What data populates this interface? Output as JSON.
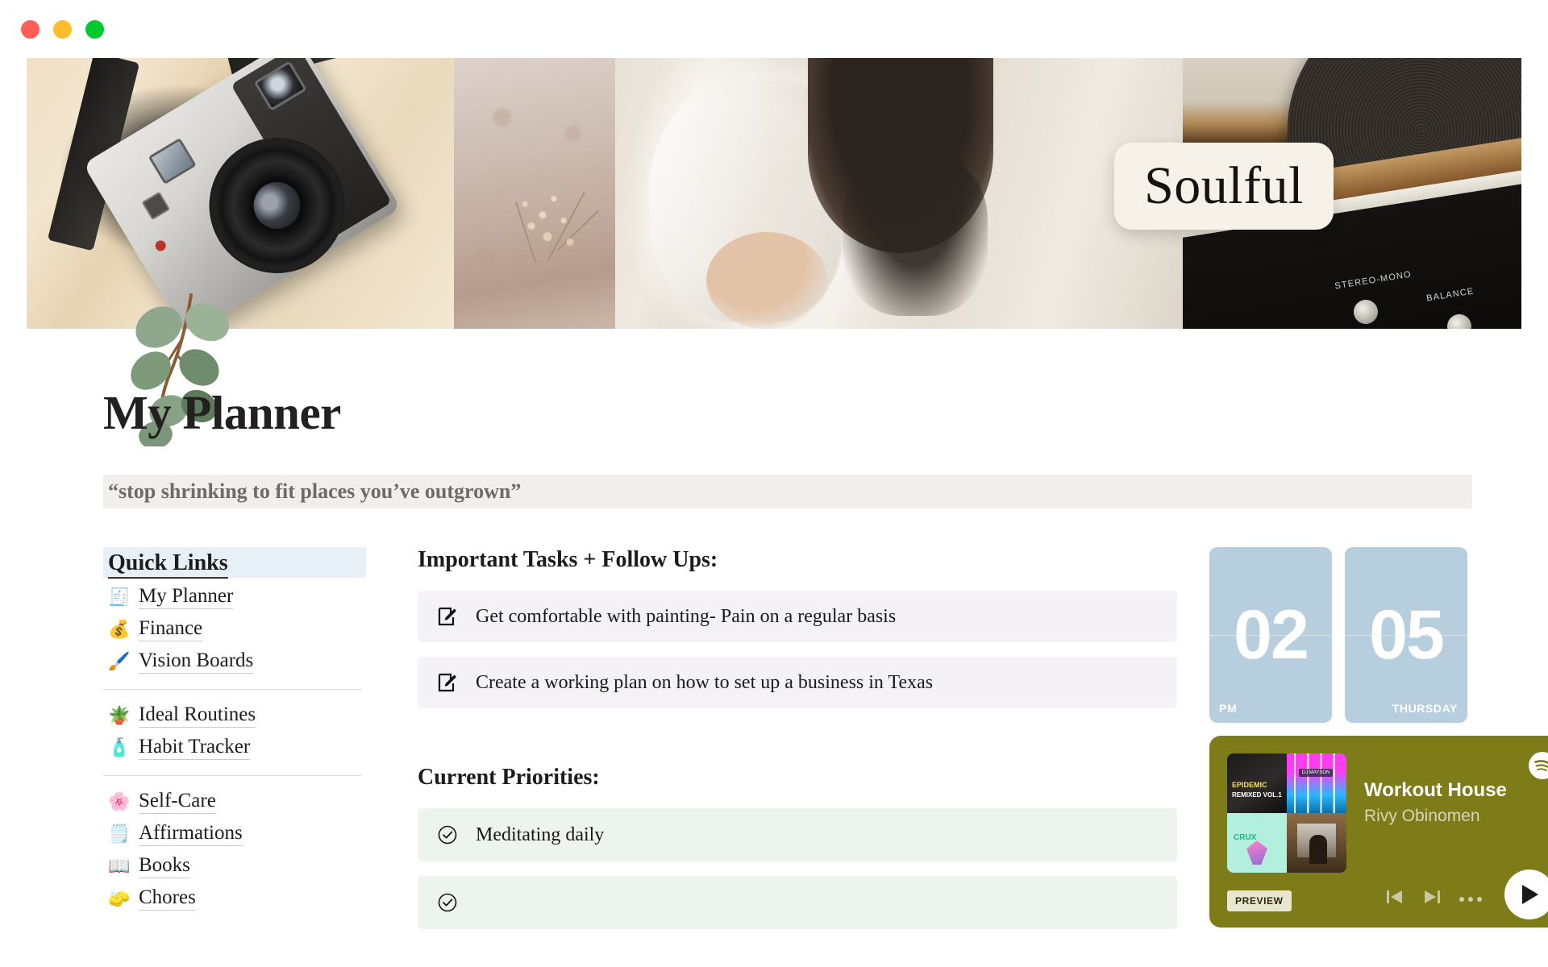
{
  "window": {
    "controls": [
      {
        "name": "close",
        "color": "#ff5f57"
      },
      {
        "name": "minimize",
        "color": "#ffbd2e"
      },
      {
        "name": "maximize",
        "color": "#00ca2e"
      }
    ]
  },
  "banner": {
    "badge_label": "Soulful",
    "record_labels": [
      "STEREO-MONO",
      "BALANCE"
    ],
    "album_text": {
      "line1": "EPIDEMIC",
      "line2": "REMIXED VOL.1",
      "chip": "DJ MAYSON",
      "crux": "CRUX"
    }
  },
  "page": {
    "title": "My Planner",
    "quote": "“stop shrinking to fit places you’ve outgrown”"
  },
  "sidebar": {
    "header": "Quick Links",
    "groups": [
      {
        "items": [
          {
            "emoji": "🧾",
            "icon": "notepad-icon",
            "label": "My Planner"
          },
          {
            "emoji": "💰",
            "icon": "money-bag-icon",
            "label": "Finance"
          },
          {
            "emoji": "🖌️",
            "icon": "paintbrush-icon",
            "label": "Vision Boards"
          }
        ]
      },
      {
        "items": [
          {
            "emoji": "🪴",
            "icon": "hanging-plant-icon",
            "label": "Ideal Routines"
          },
          {
            "emoji": "🧴",
            "icon": "lotion-bottle-icon",
            "label": "Habit Tracker"
          }
        ]
      },
      {
        "items": [
          {
            "emoji": "🌸",
            "icon": "self-care-icon",
            "label": "Self-Care"
          },
          {
            "emoji": "🗒️",
            "icon": "note-board-icon",
            "label": "Affirmations"
          },
          {
            "emoji": "📖",
            "icon": "open-book-icon",
            "label": "Books"
          },
          {
            "emoji": "🧽",
            "icon": "sponge-icon",
            "label": "Chores"
          }
        ]
      }
    ]
  },
  "main": {
    "tasks_section": {
      "title": "Important Tasks + Follow Ups:",
      "items": [
        {
          "icon": "edit-note-icon",
          "text": "Get comfortable with painting- Pain on a regular basis"
        },
        {
          "icon": "edit-note-icon",
          "text": "Create a working plan on how to set up a business in Texas"
        }
      ]
    },
    "priorities_section": {
      "title": "Current Priorities:",
      "items": [
        {
          "icon": "check-circle-icon",
          "text": "Meditating daily"
        },
        {
          "icon": "check-circle-icon",
          "text": ""
        }
      ]
    }
  },
  "rail": {
    "clock": {
      "hour": "02",
      "day_number": "05",
      "meridiem": "PM",
      "weekday": "THURSDAY",
      "panel_color": "#b6cedd"
    },
    "spotify": {
      "track_title": "Workout House",
      "artist": "Rivy Obinomen",
      "preview_label": "PREVIEW",
      "card_color": "#7d7c18",
      "controls": [
        "previous-track",
        "next-track",
        "more-options",
        "play"
      ]
    }
  }
}
